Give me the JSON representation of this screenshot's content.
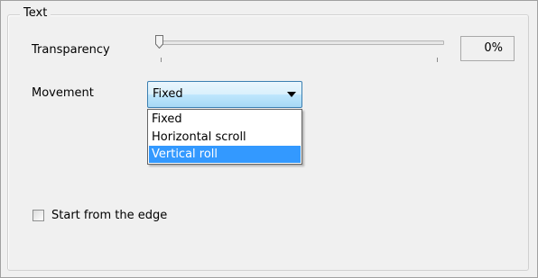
{
  "group": {
    "title": "Text"
  },
  "transparency": {
    "label": "Transparency",
    "value_text": "0%",
    "value": 0
  },
  "movement": {
    "label": "Movement",
    "selected": "Fixed",
    "options": [
      "Fixed",
      "Horizontal scroll",
      "Vertical roll"
    ],
    "highlighted": "Vertical roll"
  },
  "start_from_edge": {
    "label": "Start from the edge",
    "checked": false
  },
  "colors": {
    "highlight": "#3399ff",
    "dropdown_border": "#3c7fb1"
  },
  "icons": {
    "dropdown": "chevron-down-icon",
    "slider": "slider-thumb-icon"
  }
}
